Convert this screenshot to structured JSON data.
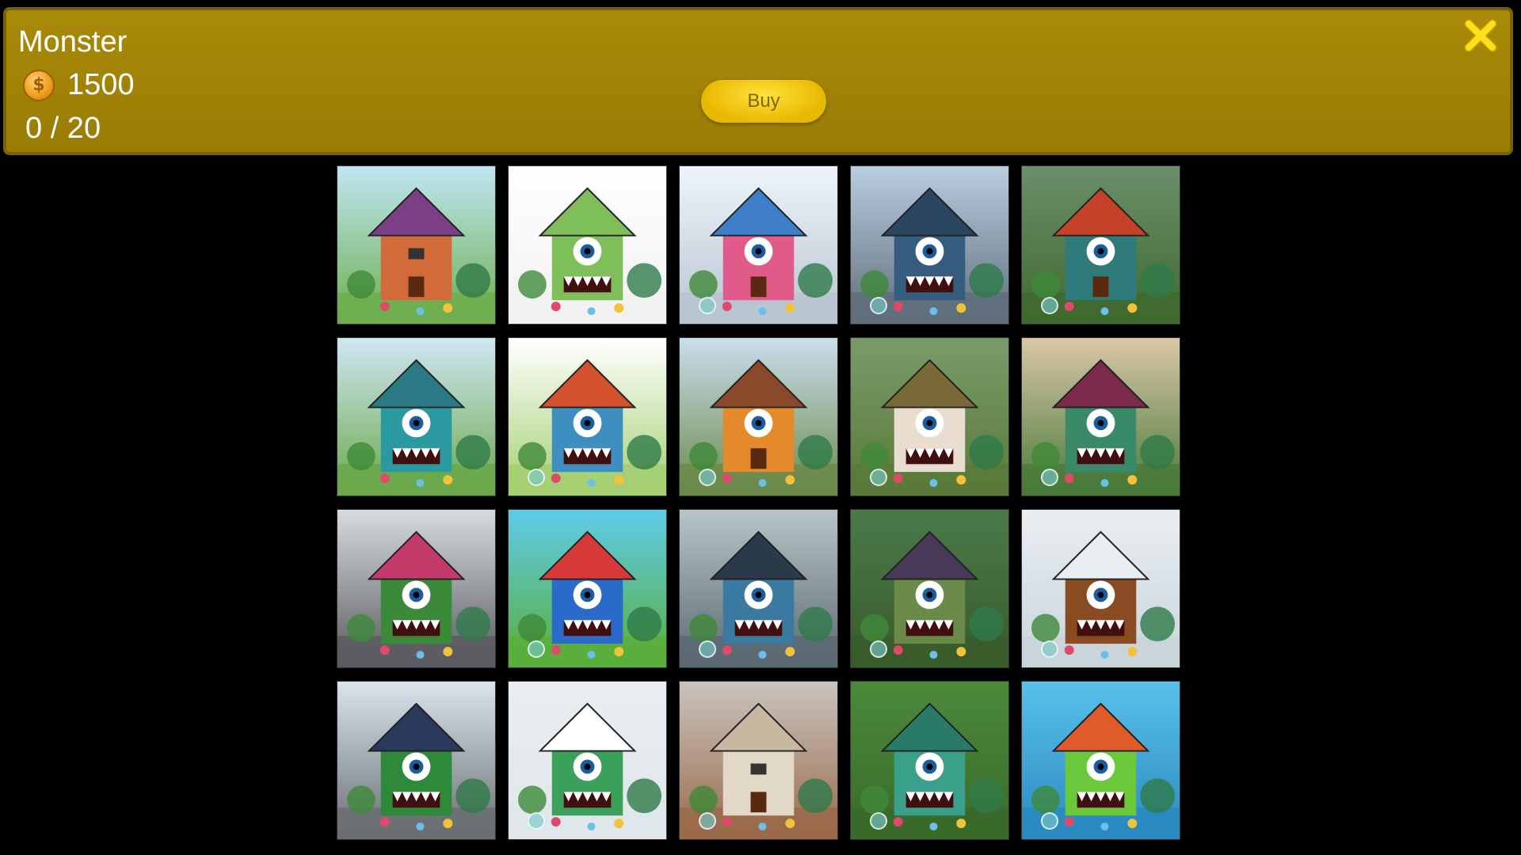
{
  "header": {
    "title": "Monster",
    "price": "1500",
    "coin_icon": "coin-icon",
    "progress": "0 / 20",
    "buy_label": "Buy",
    "close_icon": "close-icon",
    "accent": "#9a7c05",
    "buy_color": "#f5c800"
  },
  "puzzles": [
    {
      "scene": "meadow",
      "bg1": "#bfe6f2",
      "bg2": "#6fae4e",
      "house": "#d36a3a",
      "roof": "#7a3f86",
      "eye": false,
      "teeth": false,
      "badge": false
    },
    {
      "scene": "white",
      "bg1": "#ffffff",
      "bg2": "#f1f1f1",
      "house": "#7fbf5a",
      "roof": "#7fbf5a",
      "eye": true,
      "teeth": true,
      "badge": false
    },
    {
      "scene": "street",
      "bg1": "#eef4fb",
      "bg2": "#b9c4d0",
      "house": "#e05a8a",
      "roof": "#3f7fc9",
      "eye": true,
      "teeth": false,
      "badge": true
    },
    {
      "scene": "city",
      "bg1": "#b9cde0",
      "bg2": "#5f6e7a",
      "house": "#345d80",
      "roof": "#2a4660",
      "eye": true,
      "teeth": true,
      "badge": true
    },
    {
      "scene": "forest",
      "bg1": "#6b8f6a",
      "bg2": "#3f6a2f",
      "house": "#2f7a7a",
      "roof": "#c5412a",
      "eye": true,
      "teeth": false,
      "badge": true
    },
    {
      "scene": "garden",
      "bg1": "#cfe7f3",
      "bg2": "#6aa84a",
      "house": "#2a9aa0",
      "roof": "#2a7a86",
      "eye": true,
      "teeth": true,
      "badge": false
    },
    {
      "scene": "white",
      "bg1": "#ffffff",
      "bg2": "#a5cf72",
      "house": "#3e8fc0",
      "roof": "#d4512e",
      "eye": true,
      "teeth": true,
      "badge": true
    },
    {
      "scene": "village",
      "bg1": "#c9ddec",
      "bg2": "#6b8a4a",
      "house": "#e58a2a",
      "roof": "#8a4a2a",
      "eye": true,
      "teeth": false,
      "badge": true
    },
    {
      "scene": "cottage",
      "bg1": "#7a9a6a",
      "bg2": "#5a7a3a",
      "house": "#e8ddcf",
      "roof": "#7a6a3a",
      "eye": true,
      "teeth": true,
      "badge": true
    },
    {
      "scene": "autumn",
      "bg1": "#d8c7a8",
      "bg2": "#4a7a3a",
      "house": "#3a8a6a",
      "roof": "#7a2a4a",
      "eye": true,
      "teeth": true,
      "badge": true
    },
    {
      "scene": "city",
      "bg1": "#d6dbe0",
      "bg2": "#5a5a60",
      "house": "#3a8a3a",
      "roof": "#c43a6a",
      "eye": true,
      "teeth": true,
      "badge": false
    },
    {
      "scene": "garden",
      "bg1": "#5ecbea",
      "bg2": "#5aae3a",
      "house": "#2a6ac8",
      "roof": "#d83a3a",
      "eye": true,
      "teeth": true,
      "badge": true
    },
    {
      "scene": "shore",
      "bg1": "#b8c4c8",
      "bg2": "#5a6a72",
      "house": "#3a7aa0",
      "roof": "#2a3a4a",
      "eye": true,
      "teeth": true,
      "badge": true
    },
    {
      "scene": "forest",
      "bg1": "#4a7a4a",
      "bg2": "#3a5a2a",
      "house": "#6a8a4a",
      "roof": "#4a3a5a",
      "eye": true,
      "teeth": true,
      "badge": true
    },
    {
      "scene": "snow",
      "bg1": "#e9eef2",
      "bg2": "#c9d4da",
      "house": "#8a4a22",
      "roof": "#e9eef2",
      "eye": true,
      "teeth": true,
      "badge": true
    },
    {
      "scene": "city",
      "bg1": "#d9e4ec",
      "bg2": "#6a6e72",
      "house": "#2e8a3a",
      "roof": "#2a3a5a",
      "eye": true,
      "teeth": true,
      "badge": false
    },
    {
      "scene": "snow",
      "bg1": "#e9eef2",
      "bg2": "#dfe6ea",
      "house": "#3aa05a",
      "roof": "#ffffff",
      "eye": true,
      "teeth": true,
      "badge": true
    },
    {
      "scene": "desert",
      "bg1": "#c9c4bd",
      "bg2": "#9a6a4a",
      "house": "#e2d8c8",
      "roof": "#c9b8a0",
      "eye": false,
      "teeth": false,
      "badge": true
    },
    {
      "scene": "forest",
      "bg1": "#4a8a3a",
      "bg2": "#3a6a2a",
      "house": "#3aa08a",
      "roof": "#2a7a6a",
      "eye": true,
      "teeth": true,
      "badge": true
    },
    {
      "scene": "underwater",
      "bg1": "#5ac0ea",
      "bg2": "#2a8ac0",
      "house": "#6ac83a",
      "roof": "#e05a2a",
      "eye": true,
      "teeth": true,
      "badge": true
    }
  ]
}
